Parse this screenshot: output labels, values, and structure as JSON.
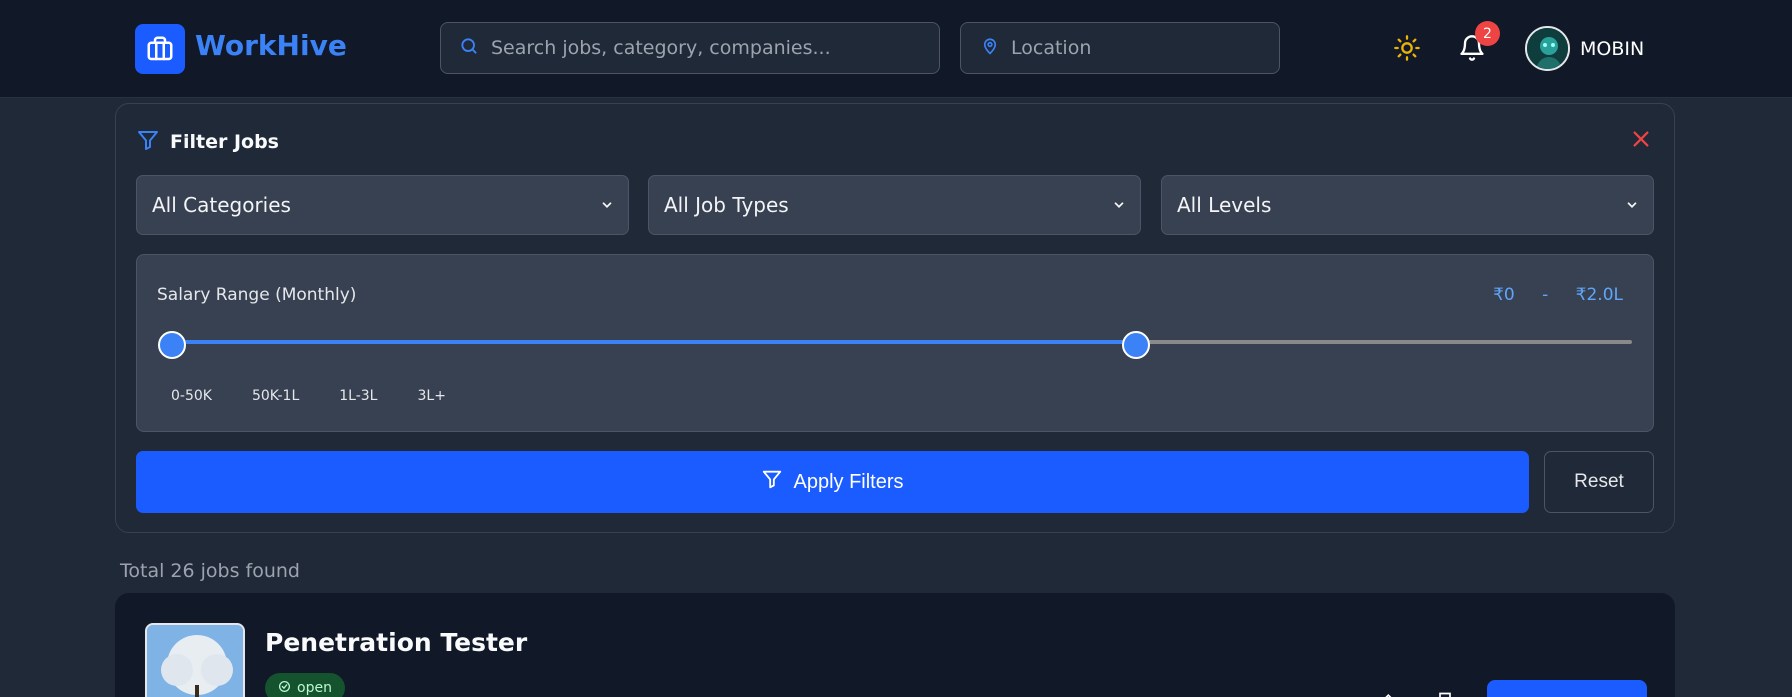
{
  "header": {
    "brand": "WorkHive",
    "search_placeholder": "Search jobs, category, companies...",
    "location_placeholder": "Location",
    "notification_count": "2",
    "username": "MOBIN"
  },
  "filters": {
    "title": "Filter Jobs",
    "category_select": "All Categories",
    "job_type_select": "All Job Types",
    "level_select": "All Levels",
    "salary": {
      "label": "Salary Range (Monthly)",
      "min_label": "₹0",
      "separator": "-",
      "max_label": "₹2.0L",
      "min_fraction": 0.0,
      "max_fraction": 0.66,
      "ticks": [
        "0-50K",
        "50K-1L",
        "1L-3L",
        "3L+"
      ]
    },
    "apply_label": "Apply Filters",
    "reset_label": "Reset"
  },
  "results": {
    "total_text": "Total 26 jobs found",
    "jobs": [
      {
        "title": "Penetration Tester",
        "status": "open"
      }
    ]
  },
  "colors": {
    "accent": "#1a5cff",
    "close": "#ef4444",
    "sun": "#eab308"
  }
}
